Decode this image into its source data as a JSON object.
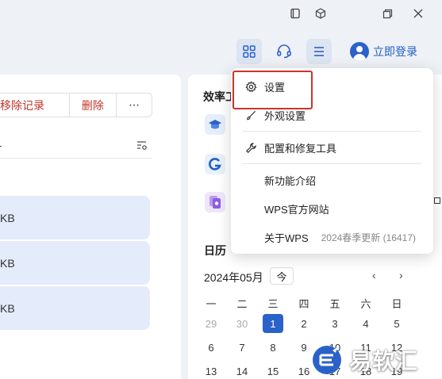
{
  "window_controls": [
    "restore-icon",
    "cube-icon",
    "maximize-icon",
    "close-icon"
  ],
  "toolbar": {
    "buttons": [
      "grid-icon",
      "headset-icon",
      "menu-icon"
    ],
    "login_label": "立即登录"
  },
  "left_panel": {
    "actions": [
      "移除记录",
      "删除",
      "⋯"
    ],
    "header_text": "-",
    "files": [
      {
        "size": "KB"
      },
      {
        "size": "KB"
      },
      {
        "size": "KB"
      }
    ]
  },
  "right_panel": {
    "efficiency_title": "效率工",
    "tool_icons": [
      "graduation-cap-icon",
      "g-logo-icon",
      "purple-doc-icon"
    ],
    "calendar": {
      "title": "日历",
      "month": "2024年05月",
      "today_label": "今",
      "prev": "‹",
      "next": "›",
      "weekdays": [
        "一",
        "二",
        "三",
        "四",
        "五",
        "六",
        "日"
      ],
      "rows": [
        [
          {
            "d": "29",
            "muted": true
          },
          {
            "d": "30",
            "muted": true
          },
          {
            "d": "1",
            "selected": true
          },
          {
            "d": "2"
          },
          {
            "d": "3"
          },
          {
            "d": "4"
          },
          {
            "d": "5"
          }
        ],
        [
          {
            "d": "6"
          },
          {
            "d": "7"
          },
          {
            "d": "8"
          },
          {
            "d": "9"
          },
          {
            "d": "10"
          },
          {
            "d": "11"
          },
          {
            "d": "12"
          }
        ],
        [
          {
            "d": "13"
          },
          {
            "d": "14"
          },
          {
            "d": "15"
          },
          {
            "d": "16"
          },
          {
            "d": "17"
          },
          {
            "d": "18"
          },
          {
            "d": "19"
          }
        ]
      ]
    }
  },
  "dropdown_menu": {
    "items": [
      {
        "icon": "gear-icon",
        "label": "设置"
      },
      {
        "icon": "brush-icon",
        "label": "外观设置"
      },
      {
        "icon": "wrench-icon",
        "label": "配置和修复工具"
      },
      {
        "icon": "",
        "label": "新功能介绍"
      },
      {
        "icon": "",
        "label": "WPS官方网站"
      },
      {
        "icon": "",
        "label": "关于WPS"
      }
    ],
    "version": "2024春季更新 (16417)"
  },
  "watermark": {
    "text": "易软汇"
  },
  "colors": {
    "accent": "#2a62c9",
    "danger": "#c0352b",
    "highlight": "#c9352b"
  }
}
